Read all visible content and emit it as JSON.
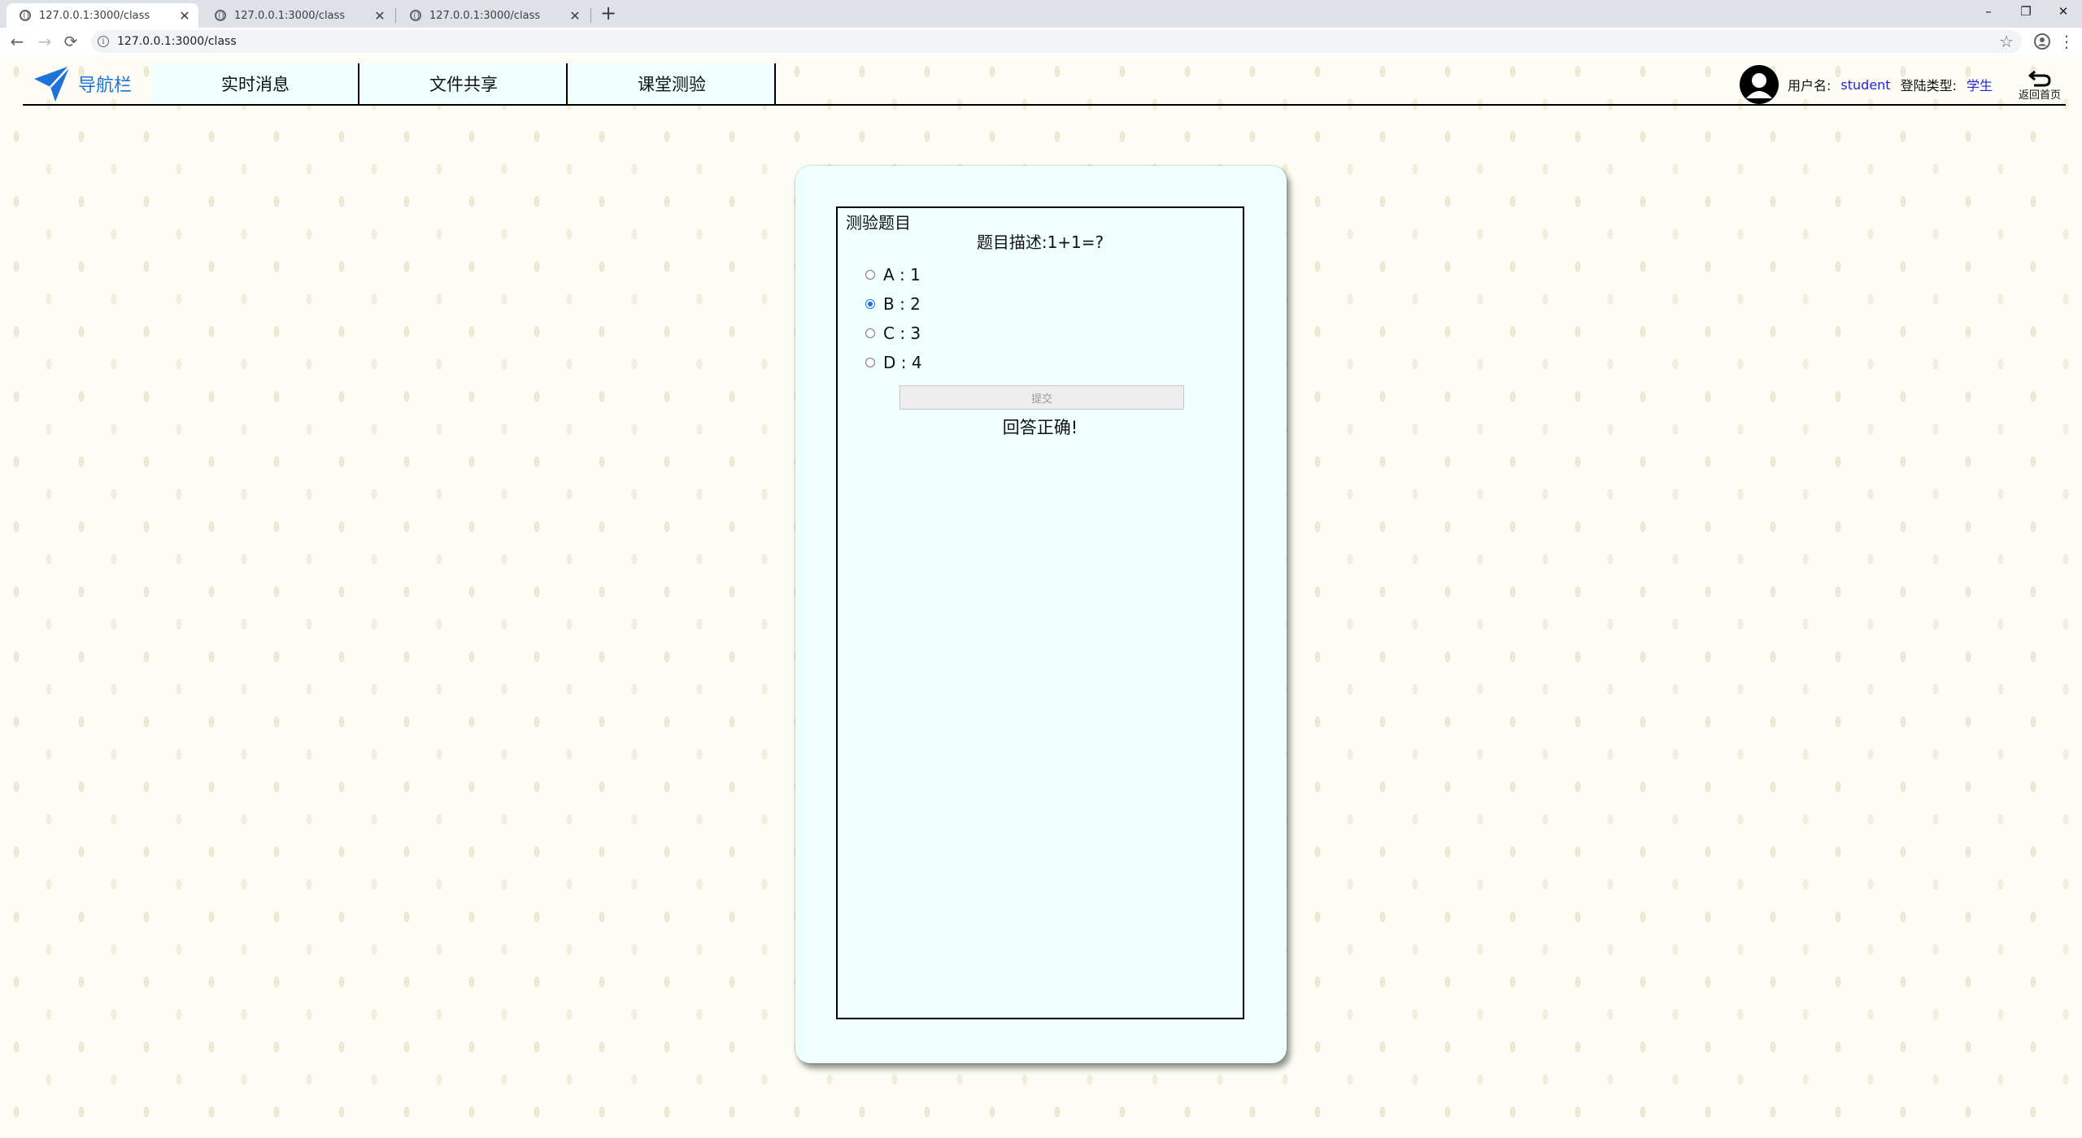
{
  "browser": {
    "tabs": [
      {
        "title": "127.0.0.1:3000/class",
        "active": true
      },
      {
        "title": "127.0.0.1:3000/class",
        "active": false
      },
      {
        "title": "127.0.0.1:3000/class",
        "active": false
      }
    ],
    "new_tab": "+",
    "url": "127.0.0.1:3000/class",
    "window_controls": {
      "minimize": "–",
      "restore": "❐",
      "close": "✕"
    }
  },
  "navbar": {
    "brand": "导航栏",
    "menu": [
      "实时消息",
      "文件共享",
      "课堂测验"
    ],
    "user": {
      "username_label": "用户名:",
      "username": "student",
      "login_type_label": "登陆类型:",
      "login_type": "学生"
    },
    "back_label": "返回首页"
  },
  "quiz": {
    "legend": "测验题目",
    "question": "题目描述:1+1=?",
    "options": [
      {
        "text": "A : 1",
        "checked": false
      },
      {
        "text": "B : 2",
        "checked": true
      },
      {
        "text": "C : 3",
        "checked": false
      },
      {
        "text": "D : 4",
        "checked": false
      }
    ],
    "submit_label": "提交",
    "result": "回答正确!"
  },
  "colors": {
    "brand": "#1e73d8",
    "menu_bg": "#eefffd",
    "user_value": "#2424d6",
    "card_bg": "#eefffe",
    "radio_checked": "#1a73e8"
  }
}
